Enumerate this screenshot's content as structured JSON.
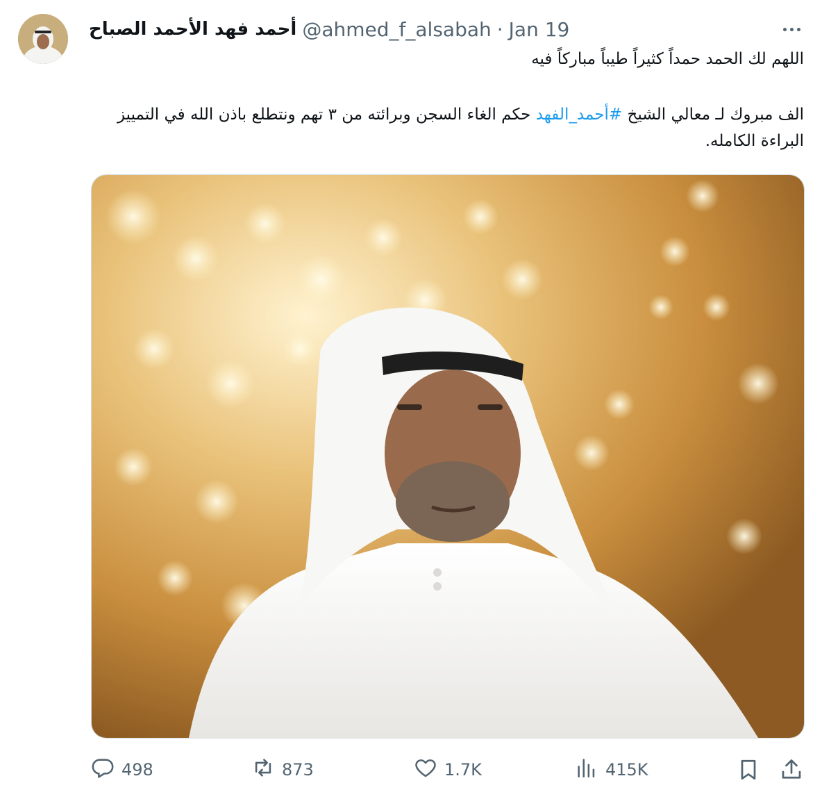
{
  "tweet": {
    "author": {
      "display_name": "أحمد فهد الأحمد الصباح",
      "handle": "@ahmed_f_alsabah",
      "date": "Jan 19",
      "separator": "·"
    },
    "text_line1": "اللهم لك الحمد حمداً كثيراً طيباً مباركاً فيه",
    "text_part1": "الف مبروك لـ معالي الشيخ ",
    "hashtag": "#أحمد_الفهد",
    "text_part2": " حكم الغاء السجن وبرائته من ٣ تهم ونتطلع باذن الله في التمييز البراءة الكامله.",
    "media": {
      "type": "photo"
    },
    "actions": {
      "replies": "498",
      "reposts": "873",
      "likes": "1.7K",
      "views": "415K"
    }
  },
  "icons": {
    "more": "more-icon",
    "reply": "reply-icon",
    "repost": "repost-icon",
    "like": "like-icon",
    "views": "views-icon",
    "bookmark": "bookmark-icon",
    "share": "share-icon"
  },
  "colors": {
    "link": "#1d9bf0",
    "muted": "#536471",
    "text": "#0f1419"
  }
}
